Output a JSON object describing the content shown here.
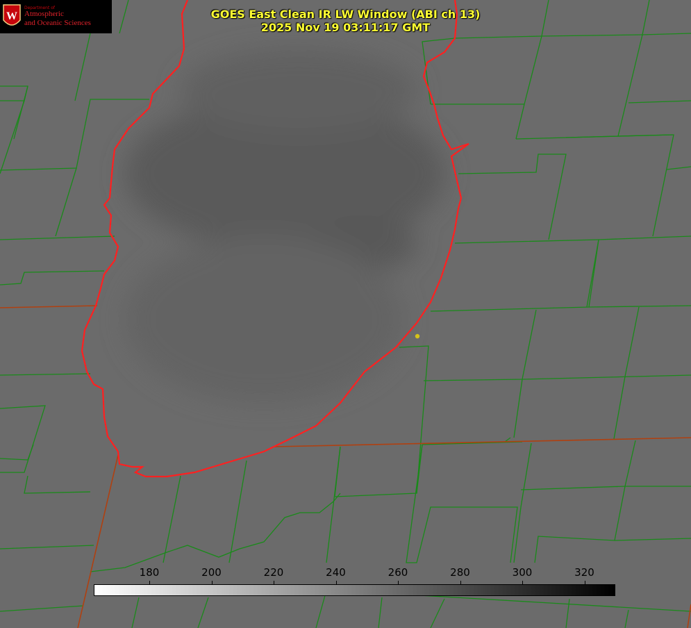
{
  "logo": {
    "department": "Department of",
    "line1": "Atmospheric",
    "line2": "and Oceanic Sciences",
    "seal_letter": "W",
    "seal_color": "#c5050c"
  },
  "title": {
    "line1": "GOES East Clean IR LW Window (ABI ch 13)",
    "line2": "2025 Nov 19 03:11:17 GMT",
    "color": "#ffff33"
  },
  "colorbar": {
    "ticks": [
      "180",
      "200",
      "220",
      "240",
      "260",
      "280",
      "300",
      "320"
    ],
    "low_color": "#ffffff",
    "high_color": "#000000"
  },
  "map": {
    "county_border_color": "#1a8a1a",
    "state_border_color": "#b04010",
    "coastline_color": "#ff2020",
    "marker_color": "#d4c21a"
  }
}
